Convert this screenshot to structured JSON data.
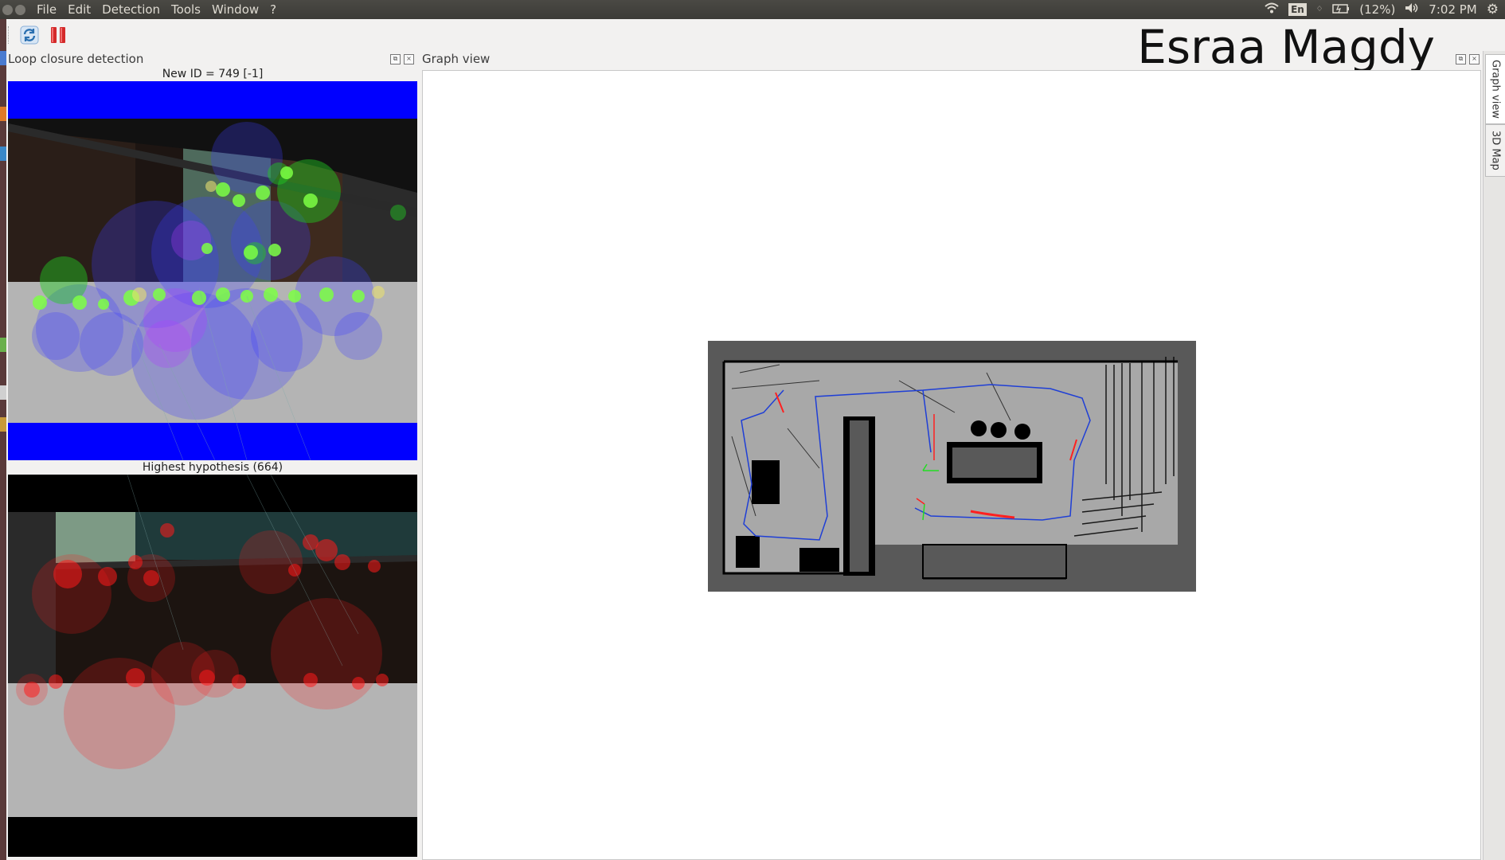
{
  "menubar": {
    "menus": [
      "File",
      "Edit",
      "Detection",
      "Tools",
      "Window",
      "?"
    ],
    "keyboard_layout": "En",
    "battery": "(12%)",
    "clock": "7:02 PM",
    "icons": [
      "wifi-icon",
      "bluetooth-icon",
      "battery-icon",
      "volume-icon",
      "gear-icon"
    ]
  },
  "toolbar": {
    "buttons": [
      {
        "name": "refresh",
        "icon": "refresh-icon",
        "color": "#2a6fb0"
      },
      {
        "name": "pause",
        "icon": "pause-icon",
        "color": "#d42a2a"
      }
    ]
  },
  "header": {
    "owner_title": "Esraa Magdy"
  },
  "loop_closure_dock": {
    "title": "Loop closure detection",
    "new_id_caption": "New ID = 749 [-1]",
    "hypothesis_caption": "Highest hypothesis (664)"
  },
  "graph_view_dock": {
    "title": "Graph view"
  },
  "side_tabs": [
    "Graph view",
    "3D Map"
  ],
  "colors": {
    "new_image_features": "#22cc22",
    "new_image_words": "#2222ff",
    "hypothesis_features": "#ff1a1a",
    "map_occupied": "#000000",
    "map_free": "#a8a8a8",
    "map_unknown": "#595959",
    "trajectory": "#1f3fd6"
  }
}
